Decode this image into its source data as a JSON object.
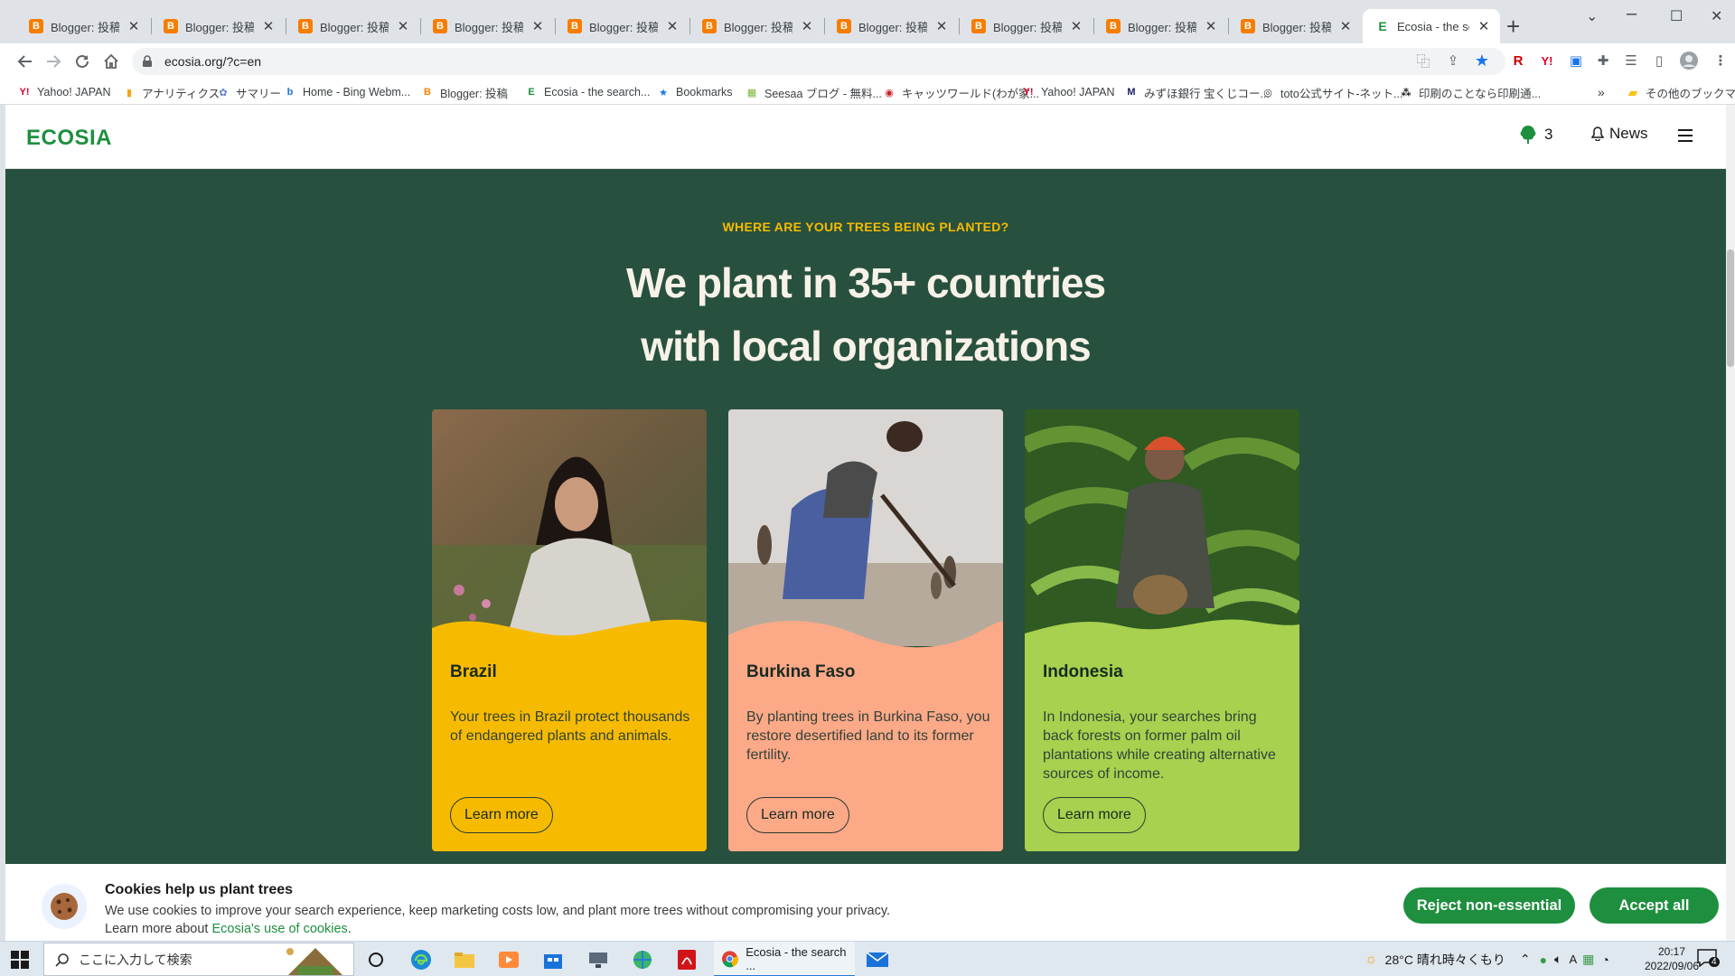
{
  "browser": {
    "tabs": [
      {
        "title": "Blogger: 投稿",
        "icon": "blogger-icon"
      },
      {
        "title": "Blogger: 投稿",
        "icon": "blogger-icon"
      },
      {
        "title": "Blogger: 投稿",
        "icon": "blogger-icon"
      },
      {
        "title": "Blogger: 投稿",
        "icon": "blogger-icon"
      },
      {
        "title": "Blogger: 投稿",
        "icon": "blogger-icon"
      },
      {
        "title": "Blogger: 投稿",
        "icon": "blogger-icon"
      },
      {
        "title": "Blogger: 投稿",
        "icon": "blogger-icon"
      },
      {
        "title": "Blogger: 投稿",
        "icon": "blogger-icon"
      },
      {
        "title": "Blogger: 投稿",
        "icon": "blogger-icon"
      },
      {
        "title": "Blogger: 投稿",
        "icon": "blogger-icon"
      },
      {
        "title": "Ecosia - the sea",
        "icon": "ecosia-icon",
        "active": true
      }
    ],
    "url": "ecosia.org/?c=en",
    "bookmarks": [
      {
        "label": "Yahoo! JAPAN",
        "icon": "yahoo-icon"
      },
      {
        "label": "アナリティクス",
        "icon": "analytics-icon"
      },
      {
        "label": "サマリー",
        "icon": "summary-icon"
      },
      {
        "label": "Home - Bing Webm...",
        "icon": "bing-icon"
      },
      {
        "label": "Blogger: 投稿",
        "icon": "blogger-icon"
      },
      {
        "label": "Ecosia - the search...",
        "icon": "ecosia-icon"
      },
      {
        "label": "Bookmarks",
        "icon": "star-icon"
      },
      {
        "label": "Seesaa ブログ - 無料...",
        "icon": "seesaa-icon"
      },
      {
        "label": "キャッツワールド(わが家...",
        "icon": "catsworld-icon"
      },
      {
        "label": "Yahoo! JAPAN",
        "icon": "yahoo-icon"
      },
      {
        "label": "みずほ銀行 宝くじコー...",
        "icon": "mizuho-icon"
      },
      {
        "label": "toto公式サイト-ネット...",
        "icon": "toto-icon"
      },
      {
        "label": "印刷のことなら印刷通...",
        "icon": "print-icon"
      }
    ],
    "bookmarks_more": "»",
    "other_bookmarks": "その他のブックマーク"
  },
  "page": {
    "logo": "ECOSIA",
    "tree_count": "3",
    "news_label": "News",
    "eyebrow": "WHERE ARE YOUR TREES BEING PLANTED?",
    "headline_line1": "We plant in 35+ countries",
    "headline_line2": "with local organizations",
    "cards": [
      {
        "title": "Brazil",
        "description": "Your trees in Brazil protect thousands of endangered plants and animals.",
        "button": "Learn more",
        "color": "#f6bb00"
      },
      {
        "title": "Burkina Faso",
        "description": "By planting trees in Burkina Faso, you restore desertified land to its former fertility.",
        "button": "Learn more",
        "color": "#fca987"
      },
      {
        "title": "Indonesia",
        "description": "In Indonesia, your searches bring back forests on former palm oil plantations while creating alternative sources of income.",
        "button": "Learn more",
        "color": "#a7d14e"
      }
    ]
  },
  "cookie_banner": {
    "title": "Cookies help us plant trees",
    "text": "We use cookies to improve your search experience, keep marketing costs low, and plant more trees without compromising your privacy.",
    "learn_prefix": "Learn more about ",
    "learn_link": "Ecosia's use of cookies",
    "learn_suffix": ".",
    "reject_label": "Reject non-essential",
    "accept_label": "Accept all"
  },
  "taskbar": {
    "search_placeholder": "ここに入力して検索",
    "chrome_label": "Ecosia - the search ...",
    "weather": "28°C  晴れ時々くもり",
    "ime": "A",
    "time": "20:17",
    "date": "2022/09/06",
    "notifications": "4"
  },
  "colors": {
    "ecosia_green": "#1e8f3e",
    "page_bg": "#28503e",
    "eyebrow": "#f6bb00",
    "headline": "#f7f2e8"
  }
}
